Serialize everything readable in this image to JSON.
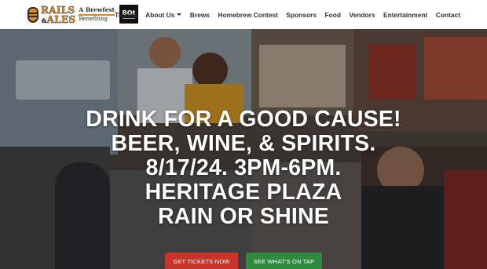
{
  "header": {
    "logo": {
      "line1": "RAILS",
      "amp": "&",
      "line2": "ALES",
      "tag1": "A Brewfest",
      "tag2": "Benefiting",
      "partner": "BOt"
    },
    "nav": [
      {
        "label": "Tickets"
      },
      {
        "label": "About Us",
        "has_dropdown": true
      },
      {
        "label": "Brews"
      },
      {
        "label": "Homebrew Contest"
      },
      {
        "label": "Sponsors"
      },
      {
        "label": "Food"
      },
      {
        "label": "Vendors"
      },
      {
        "label": "Entertainment"
      },
      {
        "label": "Contact"
      }
    ]
  },
  "hero": {
    "lines": [
      "DRINK FOR A GOOD CAUSE!",
      "BEER, WINE, & SPIRITS.",
      "8/17/24. 3PM-6PM.",
      "HERITAGE PLAZA",
      "RAIN OR SHINE"
    ],
    "buttons": {
      "tickets": "GET TICKETS NOW",
      "tap": "SEE WHAT'S ON TAP"
    }
  },
  "colors": {
    "brand_orange": "#e08a1e",
    "tickets_button": "#c8332b",
    "tap_button": "#2f8a40"
  }
}
